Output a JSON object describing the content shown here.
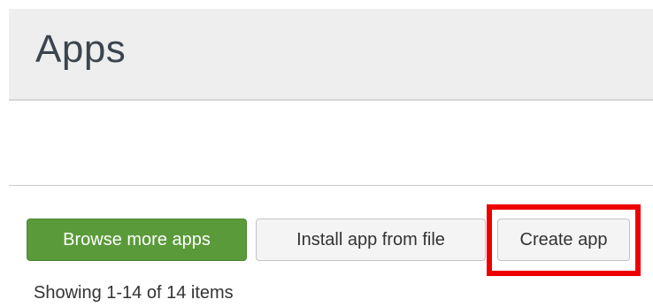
{
  "header": {
    "title": "Apps"
  },
  "toolbar": {
    "browse_label": "Browse more apps",
    "install_label": "Install app from file",
    "create_label": "Create app"
  },
  "pagination": {
    "summary": "Showing 1-14 of 14 items"
  },
  "colors": {
    "primary_button": "#5a9a3a",
    "highlight": "#ee0000",
    "header_background": "#eeeeee"
  }
}
